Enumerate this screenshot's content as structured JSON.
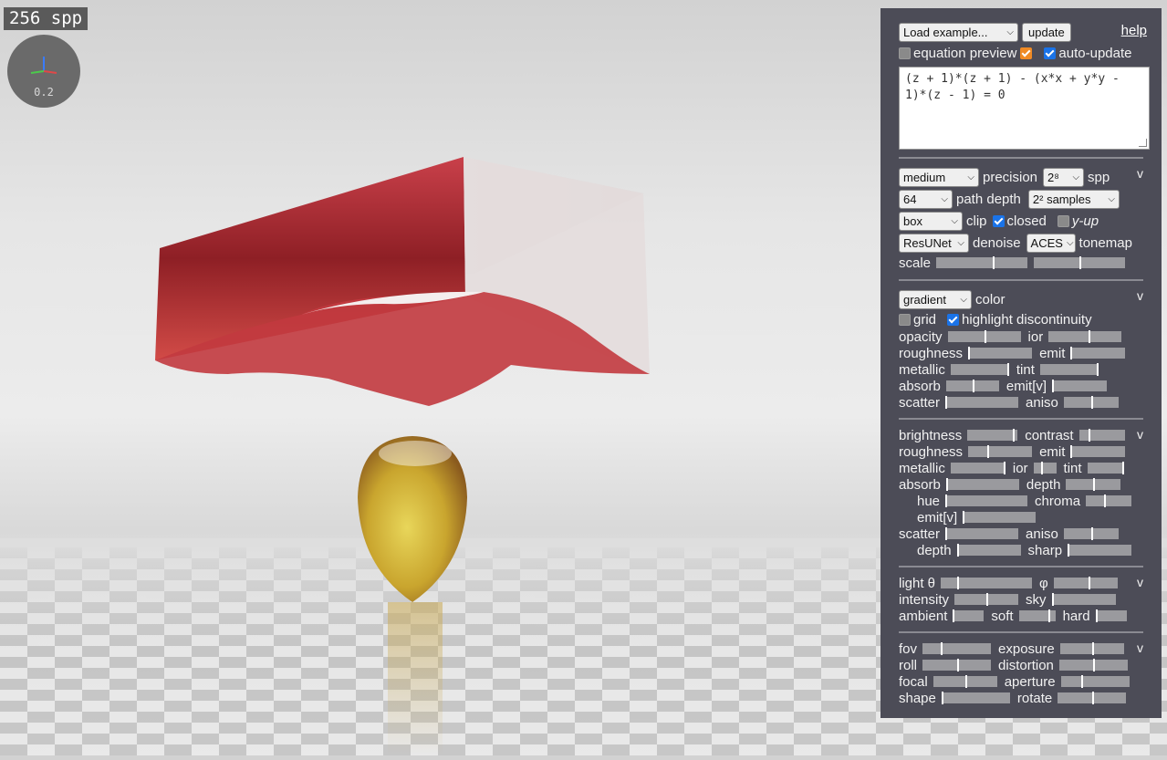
{
  "render": {
    "spp_counter": "256 spp",
    "axes_scale": "0.2"
  },
  "panel": {
    "help": "help",
    "load_example": "Load example...",
    "update": "update",
    "equation_preview": "equation preview",
    "equation_preview_checked": false,
    "equation_preview_color_checked": true,
    "auto_update": "auto-update",
    "auto_update_checked": true,
    "equation": "(z + 1)*(z + 1) - (x*x + y*y - 1)*(z - 1) = 0",
    "render_section": {
      "precision_value": "medium",
      "precision_label": "precision",
      "spp_value": "2⁸",
      "spp_label": "spp",
      "path_depth_value": "64",
      "path_depth_label": "path depth",
      "samples_value": "2² samples",
      "clip_value": "box",
      "clip_label": "clip",
      "closed_label": "closed",
      "closed_checked": true,
      "yup_label": "y-up",
      "yup_checked": false,
      "denoise_value": "ResUNet",
      "denoise_label": "denoise",
      "tonemap_value": "ACES",
      "tonemap_label": "tonemap",
      "scale_label": "scale",
      "scale_values": [
        0.62,
        0.5
      ],
      "collapse": "v"
    },
    "material_section": {
      "color_value": "gradient",
      "color_label": "color",
      "grid_label": "grid",
      "grid_checked": false,
      "highlight_label": "highlight discontinuity",
      "highlight_checked": true,
      "collapse": "v",
      "sliders": [
        {
          "label": "opacity",
          "value": 0.5,
          "label2": "ior",
          "value2": 0.55
        },
        {
          "label": "roughness",
          "value": 0.0,
          "label2": "emit",
          "value2": 0.0
        },
        {
          "label": "metallic",
          "value": 0.98,
          "label2": "tint",
          "value2": 0.98
        },
        {
          "label": "absorb",
          "value": 0.5,
          "label2": "emit[v]",
          "value2": 0.0
        },
        {
          "label": "scatter",
          "value": 0.0,
          "label2": "aniso",
          "value2": 0.5
        }
      ]
    },
    "surface_section": {
      "collapse": "v",
      "rows": [
        {
          "label": "brightness",
          "value": 0.9,
          "label2": "contrast",
          "value2": 0.2
        },
        {
          "label": "roughness",
          "value": 0.3,
          "label2": "emit",
          "value2": 0.0
        },
        {
          "label": "metallic",
          "value": 0.98,
          "label2": "ior",
          "value2": 0.35,
          "label3": "tint",
          "value3": 0.98
        },
        {
          "label": "absorb",
          "value": 0.0,
          "label2": "depth",
          "value2": 0.5
        },
        {
          "label": "hue",
          "value": 0.0,
          "label2": "chroma",
          "value2": 0.4
        },
        {
          "label": "emit[v]",
          "value": 0.0
        },
        {
          "label": "scatter",
          "value": 0.0,
          "label2": "aniso",
          "value2": 0.5
        },
        {
          "label": "depth",
          "value": 0.0,
          "label2": "sharp",
          "value2": 0.0
        }
      ]
    },
    "light_section": {
      "collapse": "v",
      "rows": [
        {
          "label": "light θ",
          "value": 0.18,
          "label2": "φ",
          "value2": 0.55
        },
        {
          "label": "intensity",
          "value": 0.5,
          "label2": "sky",
          "value2": 0.0
        },
        {
          "label": "ambient",
          "value": 0.0,
          "label2": "soft",
          "value2": 0.8,
          "label3": "hard",
          "value3": 0.0
        }
      ]
    },
    "camera_section": {
      "collapse": "v",
      "rows": [
        {
          "label": "fov",
          "value": 0.27,
          "label2": "exposure",
          "value2": 0.5
        },
        {
          "label": "roll",
          "value": 0.5,
          "label2": "distortion",
          "value2": 0.5
        },
        {
          "label": "focal",
          "value": 0.5,
          "label2": "aperture",
          "value2": 0.3
        },
        {
          "label": "shape",
          "value": 0.0,
          "label2": "rotate",
          "value2": 0.5
        }
      ]
    }
  }
}
